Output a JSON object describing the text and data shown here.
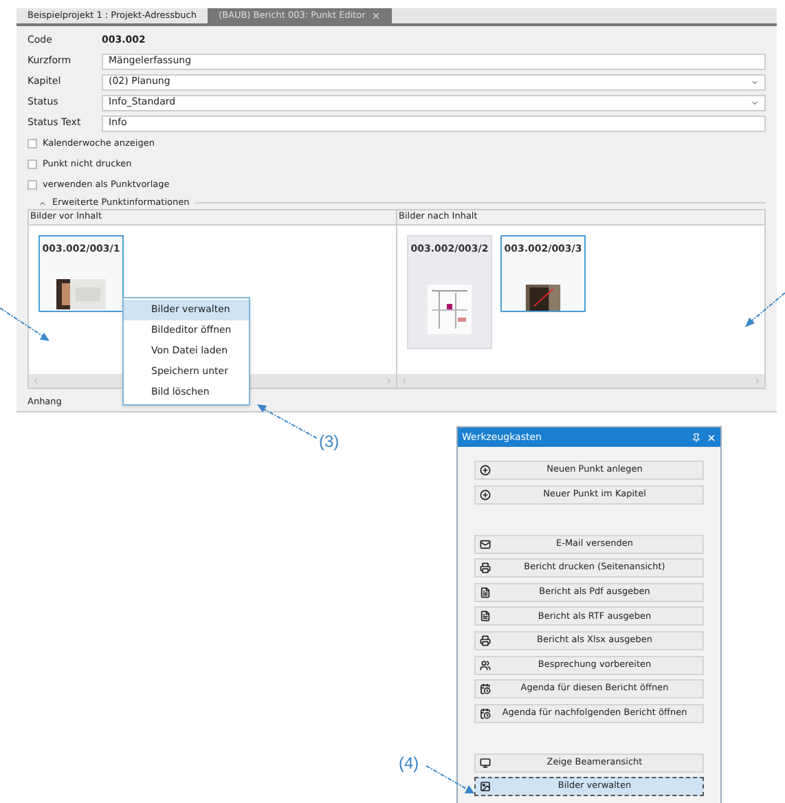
{
  "tabs": [
    {
      "label": "Beispielprojekt 1 : Projekt-Adressbuch",
      "selected": false,
      "closable": false
    },
    {
      "label": "(BAUB) Bericht 003: Punkt Editor",
      "selected": true,
      "closable": true
    }
  ],
  "fields": [
    {
      "label": "Code",
      "kind": "static",
      "value": "003.002"
    },
    {
      "label": "Kurzform",
      "kind": "text",
      "value": "Mängelerfassung"
    },
    {
      "label": "Kapitel",
      "kind": "dropdown",
      "value": "(02) Planung"
    },
    {
      "label": "Status",
      "kind": "dropdown",
      "value": "Info_Standard"
    },
    {
      "label": "Status Text",
      "kind": "text",
      "value": "Info"
    }
  ],
  "checkboxes": [
    {
      "label": "Kalenderwoche anzeigen",
      "checked": false
    },
    {
      "label": "Punkt nicht drucken",
      "checked": false
    },
    {
      "label": "verwenden als Punktvorlage",
      "checked": false
    }
  ],
  "section": {
    "title": "Erweiterte Punktinformationen",
    "expanded": true
  },
  "image_panes": [
    {
      "title": "Bilder vor Inhalt",
      "images": [
        {
          "caption": "003.002/003/1",
          "selected": true,
          "kind": "picture"
        }
      ]
    },
    {
      "title": "Bilder nach Inhalt",
      "images": [
        {
          "caption": "003.002/003/2",
          "selected": false,
          "kind": "picture"
        },
        {
          "caption": "003.002/003/3",
          "selected": true,
          "kind": "picture"
        }
      ]
    }
  ],
  "footer": "Anhang",
  "context_menu": [
    {
      "label": "Bilder verwalten",
      "selected": true
    },
    {
      "label": "Bildeditor öffnen",
      "selected": false
    },
    {
      "label": "Von Datei laden",
      "selected": false
    },
    {
      "label": "Speichern unter",
      "selected": false
    },
    {
      "label": "Bild löschen",
      "selected": false
    }
  ],
  "toolbox": {
    "title": "Werkzeugkasten",
    "groups": [
      [
        {
          "label": "Neuen Punkt anlegen",
          "kind": "add",
          "selected": false
        },
        {
          "label": "Neuer Punkt im Kapitel",
          "kind": "add",
          "selected": false
        }
      ],
      [
        {
          "label": "E-Mail versenden",
          "kind": "mail",
          "selected": false
        },
        {
          "label": "Bericht drucken (Seitenansicht)",
          "kind": "print",
          "selected": false
        },
        {
          "label": "Bericht als Pdf ausgeben",
          "kind": "export",
          "selected": false
        },
        {
          "label": "Bericht als RTF ausgeben",
          "kind": "export",
          "selected": false
        },
        {
          "label": "Bericht als Xlsx ausgeben",
          "kind": "print",
          "selected": false
        },
        {
          "label": "Besprechung vorbereiten",
          "kind": "meeting",
          "selected": false
        },
        {
          "label": "Agenda für diesen Bericht öffnen",
          "kind": "agenda",
          "selected": false
        },
        {
          "label": "Agenda für nachfolgenden Bericht öffnen",
          "kind": "agenda",
          "selected": false
        }
      ],
      [
        {
          "label": "Zeige Beameransicht",
          "kind": "beamer",
          "selected": false
        },
        {
          "label": "Bilder verwalten",
          "kind": "images",
          "selected": true
        }
      ]
    ]
  },
  "callouts": [
    {
      "label": "(3)"
    },
    {
      "label": "(4)"
    }
  ]
}
